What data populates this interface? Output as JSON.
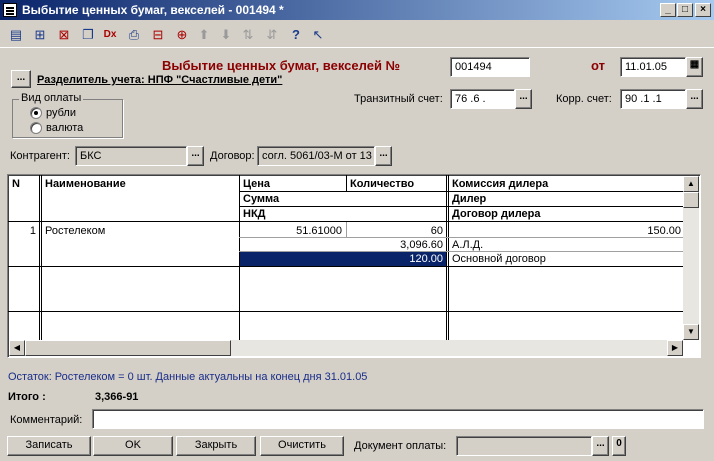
{
  "window": {
    "title": "Выбытие ценных бумаг, векселей - 001494 *",
    "minimize": "_",
    "maximize": "□",
    "close": "×"
  },
  "toolbar": {
    "icons": [
      "new-document-icon",
      "add-row-icon",
      "delete-row-icon",
      "copy-row-icon",
      "dx-report-icon",
      "print-icon",
      "edit-row-icon",
      "insert-row-icon",
      "move-up-icon",
      "move-down-icon",
      "sort-asc-icon",
      "sort-desc-icon",
      "help-icon",
      "context-help-icon"
    ],
    "dx_label": "Dx"
  },
  "header": {
    "title": "Выбытие ценных бумаг, векселей №",
    "number": "001494",
    "date_label": "от",
    "date": "11.01.05",
    "separator_button": "...",
    "separator_label": "Разделитель учета: НПФ \"Счастливые дети\"",
    "transit_label": "Транзитный счет:",
    "transit_value": "76 .6 .",
    "corr_label": "Корр. счет:",
    "corr_value": "90 .1 .1",
    "ellipsis": "..."
  },
  "payment_type": {
    "legend": "Вид оплаты",
    "options": [
      {
        "label": "рубли",
        "checked": true
      },
      {
        "label": "валюта",
        "checked": false
      }
    ]
  },
  "counterparty": {
    "label": "Контрагент:",
    "value": "БКС",
    "contract_label": "Договор:",
    "contract_value": "согл. 5061/03-М от 13"
  },
  "table": {
    "headers": {
      "n": "N",
      "name": "Наименование",
      "price": "Цена",
      "quantity": "Количество",
      "sum": "Сумма",
      "nkd": "НКД",
      "commission": "Комиссия дилера",
      "dealer": "Дилер",
      "dealer_contract": "Договор дилера"
    },
    "rows": [
      {
        "n": "1",
        "name": "Ростелеком",
        "price": "51.61000",
        "quantity": "60",
        "sum": "3,096.60",
        "nkd": "120.00",
        "commission": "150.00",
        "dealer": "А.Л.Д.",
        "dealer_contract": "Основной договор"
      }
    ]
  },
  "status": "Остаток: Ростелеком = 0 шт. Данные актуальны на конец дня 31.01.05",
  "total": {
    "label": "Итого :",
    "value": "3,366-91"
  },
  "comment": {
    "label": "Комментарий:",
    "value": ""
  },
  "buttons": {
    "save": "Записать",
    "ok": "OK",
    "close": "Закрыть",
    "clear": "Очистить"
  },
  "payment_document": {
    "label": "Документ оплаты:",
    "value": "",
    "ellipsis": "...",
    "zero": "0"
  }
}
